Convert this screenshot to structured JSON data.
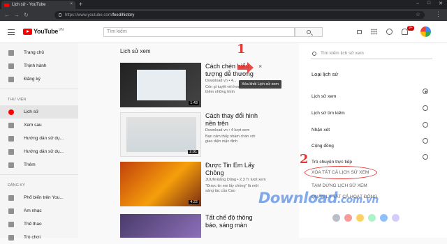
{
  "browser": {
    "tab_title": "Lịch sử - YouTube",
    "url_host": "https://www.youtube.com",
    "url_path": "/feed/history",
    "new_tab": "+",
    "tab_close": "×"
  },
  "header": {
    "logo_text": "YouTube",
    "logo_region": "VN",
    "search_placeholder": "Tìm kiếm",
    "notification_count": "9+"
  },
  "sidebar": {
    "top_items": [
      {
        "label": "Trang chủ",
        "icon": "home-icon"
      },
      {
        "label": "Thịnh hành",
        "icon": "flame-icon"
      },
      {
        "label": "Đăng ký",
        "icon": "subscriptions-icon"
      }
    ],
    "library_heading": "THƯ VIỆN",
    "library_items": [
      {
        "label": "Lịch sử",
        "icon": "history-icon",
        "active": true
      },
      {
        "label": "Xem sau",
        "icon": "clock-icon"
      },
      {
        "label": "Hướng dẫn sử dụ...",
        "icon": "playlist-icon"
      },
      {
        "label": "Hướng dẫn sử dụ...",
        "icon": "playlist-icon"
      },
      {
        "label": "Thêm",
        "icon": "chevron-down-icon"
      }
    ],
    "subscriptions_heading": "ĐĂNG KÝ",
    "subscription_items": [
      {
        "label": "Phổ biến trên You...",
        "icon": "channel-icon"
      },
      {
        "label": "Âm nhạc",
        "icon": "music-icon"
      },
      {
        "label": "Thể thao",
        "icon": "sports-icon"
      },
      {
        "label": "Trò chơi",
        "icon": "gaming-icon"
      }
    ]
  },
  "main": {
    "title": "Lịch sử xem",
    "videos": [
      {
        "title": "Cách chèn biểu tượng dễ thương",
        "meta": "Download vn • 4...",
        "desc": "Còn gì tuyệt vời hơn khi chèn thêm những hình",
        "duration": "1:43"
      },
      {
        "title": "Cách thay đổi hình nền trên",
        "meta": "Download vn • 4 lượt xem",
        "desc": "Bạn cảm thấy nhàm chán với giao diện mặc định",
        "duration": "2:01"
      },
      {
        "title": "Được Tin Em Lấy Chồng",
        "meta": "JUUN Đăng Dũng • 2,3 Tr lượt xem",
        "desc": "\"Được tin em lấy chồng\" là một sáng tác của Cao",
        "duration": "4:22"
      },
      {
        "title": "Tất chế độ thông báo, sáng màn",
        "meta": "",
        "desc": "",
        "duration": ""
      }
    ],
    "remove_tooltip": "Xóa khỏi Lịch sử xem",
    "remove_icon": "×"
  },
  "history_panel": {
    "search_placeholder": "Tìm kiếm lịch sử xem",
    "type_heading": "Loại lịch sử",
    "types": [
      {
        "label": "Lịch sử xem",
        "selected": true
      },
      {
        "label": "Lịch sử tìm kiếm",
        "selected": false
      },
      {
        "label": "Nhận xét",
        "selected": false
      },
      {
        "label": "Cộng đồng",
        "selected": false
      },
      {
        "label": "Trò chuyện trực tiếp",
        "selected": false
      }
    ],
    "clear_all": "XÓA TẤT CẢ LỊCH SỬ XEM",
    "pause": "TẠM DỪNG LỊCH SỬ XEM",
    "manage": "QUẢN LÝ TẤT CẢ HOẠT ĐỘNG"
  },
  "annotations": {
    "step1": "1",
    "step2": "2",
    "accent": "#e53935"
  },
  "watermark": {
    "main": "Download",
    "domain": ".com.vn"
  }
}
